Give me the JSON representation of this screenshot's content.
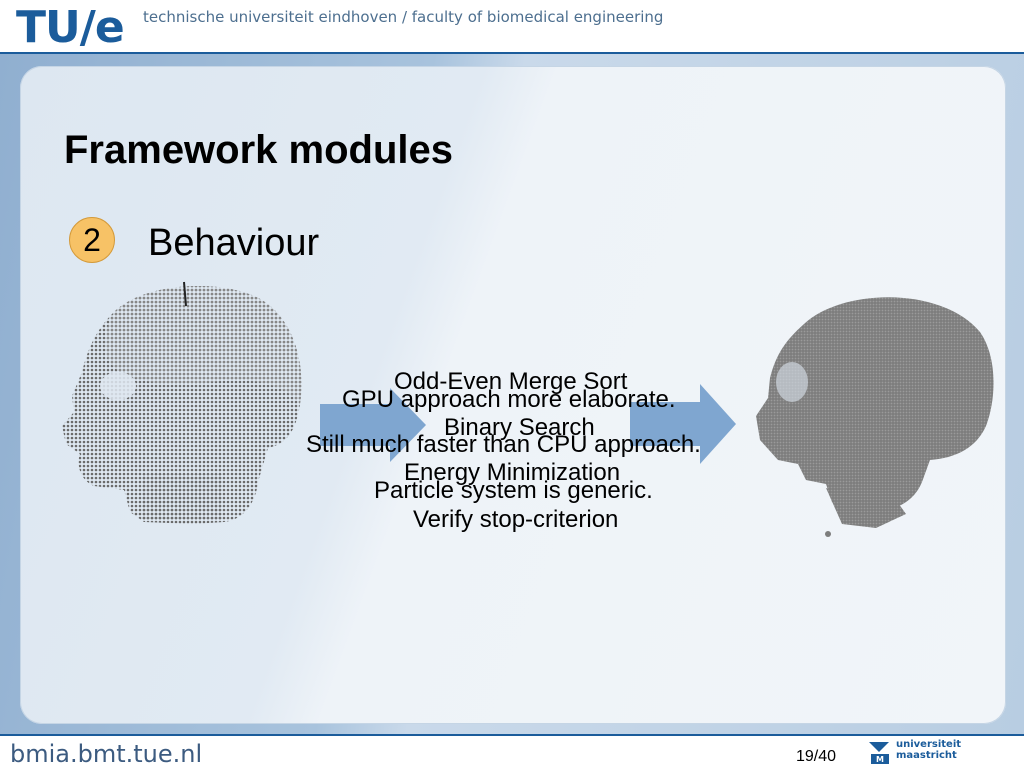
{
  "header": {
    "logo_text": "TU/e",
    "institution": "technische universiteit eindhoven / faculty of biomedical engineering"
  },
  "slide": {
    "title": "Framework modules",
    "step_number": "2",
    "step_label": "Behaviour"
  },
  "overlay_lines": [
    "Odd-Even Merge Sort",
    "GPU approach more elaborate.",
    "Binary Search",
    "Still much faster than CPU approach.",
    "Energy Minimization",
    "Particle system is generic.",
    "Verify stop-criterion"
  ],
  "footer": {
    "url": "bmia.bmt.tue.nl",
    "page": "19/40",
    "partner": "universiteit maastricht"
  },
  "colors": {
    "brand_blue": "#1b5c9b",
    "step_circle": "#f7c266",
    "arrow_blue": "#7fa6d0"
  },
  "icons": {
    "left_figure": "skull-point-cloud-icon",
    "right_figure": "skull-particle-mesh-icon",
    "arrow": "right-arrow-icon"
  }
}
